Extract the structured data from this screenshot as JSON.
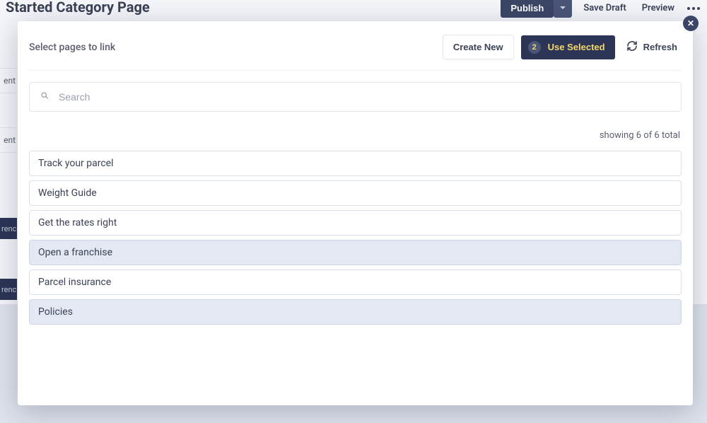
{
  "bg": {
    "title": "Started Category Page",
    "publish": "Publish",
    "save_draft": "Save Draft",
    "preview": "Preview",
    "rail1": "ent",
    "rail2": "ent",
    "tag1": "renc",
    "tag2": "renc"
  },
  "modal": {
    "title": "Select pages to link",
    "create_new": "Create New",
    "selected_count": "2",
    "use_selected": "Use Selected",
    "refresh": "Refresh",
    "search_placeholder": "Search",
    "showing_text": "showing 6 of 6 total",
    "items": [
      {
        "label": "Track your parcel",
        "selected": false
      },
      {
        "label": "Weight Guide",
        "selected": false
      },
      {
        "label": "Get the rates right",
        "selected": false
      },
      {
        "label": "Open a franchise",
        "selected": true
      },
      {
        "label": "Parcel insurance",
        "selected": false
      },
      {
        "label": "Policies",
        "selected": true
      }
    ]
  }
}
